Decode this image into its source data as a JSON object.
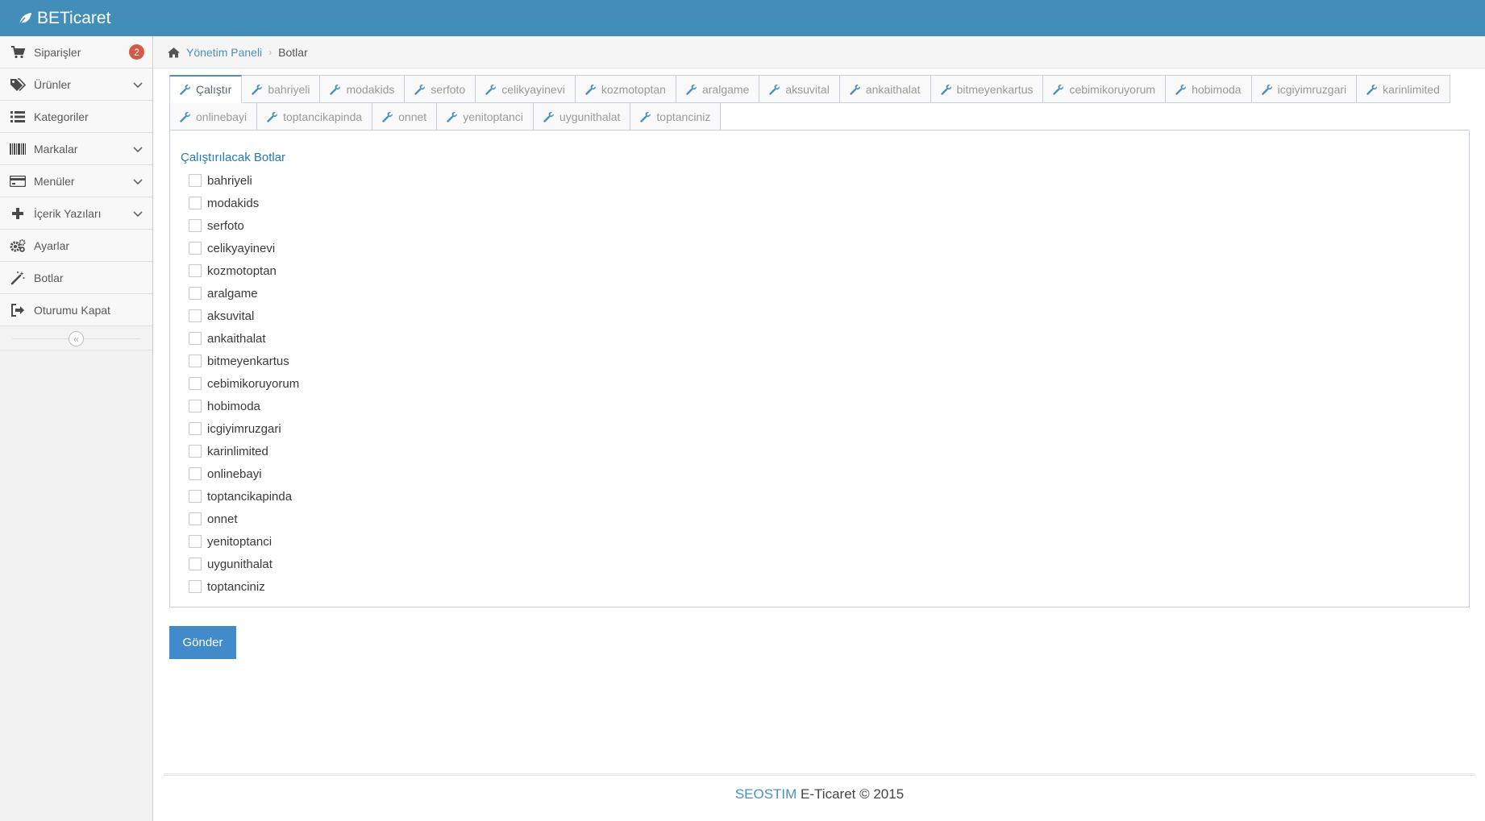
{
  "app": {
    "brand": "BETicaret"
  },
  "colors": {
    "topbar": "#438eb9",
    "accent": "#428bca",
    "badge": "#d15b47"
  },
  "sidebar": {
    "items": [
      {
        "label": "Siparişler",
        "icon": "cart-icon",
        "badge": "2",
        "expandable": false
      },
      {
        "label": "Ürünler",
        "icon": "tags-icon",
        "expandable": true
      },
      {
        "label": "Kategoriler",
        "icon": "list-icon",
        "expandable": false
      },
      {
        "label": "Markalar",
        "icon": "barcode-icon",
        "expandable": true
      },
      {
        "label": "Menüler",
        "icon": "credit-card-icon",
        "expandable": true
      },
      {
        "label": "İçerik Yazıları",
        "icon": "plus-icon",
        "expandable": true
      },
      {
        "label": "Ayarlar",
        "icon": "gears-icon",
        "expandable": false
      },
      {
        "label": "Botlar",
        "icon": "magic-wand-icon",
        "expandable": false
      },
      {
        "label": "Oturumu Kapat",
        "icon": "sign-out-icon",
        "expandable": false
      }
    ],
    "collapse_glyph": "«"
  },
  "breadcrumb": {
    "home": "Yönetim Paneli",
    "current": "Botlar"
  },
  "tabs": [
    "Çalıştır",
    "bahriyeli",
    "modakids",
    "serfoto",
    "celikyayinevi",
    "kozmotoptan",
    "aralgame",
    "aksuvital",
    "ankaithalat",
    "bitmeyenkartus",
    "cebimikoruyorum",
    "hobimoda",
    "icgiyimruzgari",
    "karinlimited",
    "onlinebayi",
    "toptancikapinda",
    "onnet",
    "yenitoptanci",
    "uygunithalat",
    "toptanciniz"
  ],
  "active_tab": 0,
  "form": {
    "title": "Çalıştırılacak Botlar",
    "bots": [
      "bahriyeli",
      "modakids",
      "serfoto",
      "celikyayinevi",
      "kozmotoptan",
      "aralgame",
      "aksuvital",
      "ankaithalat",
      "bitmeyenkartus",
      "cebimikoruyorum",
      "hobimoda",
      "icgiyimruzgari",
      "karinlimited",
      "onlinebayi",
      "toptancikapinda",
      "onnet",
      "yenitoptanci",
      "uygunithalat",
      "toptanciniz"
    ],
    "submit_label": "Gönder"
  },
  "footer": {
    "brand": "SEOSTIM",
    "text": " E-Ticaret © 2015"
  }
}
